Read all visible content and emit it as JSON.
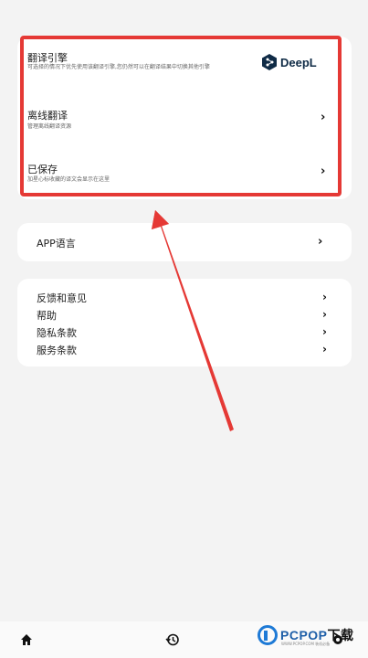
{
  "engine_card": {
    "translation_engine": {
      "title": "翻译引擎",
      "desc": "可选择的情况下优先使用该翻译引擎,您仍然可以在翻译结果中切换其他引擎",
      "logo_text": "DeepL",
      "logo_icon": "deepl-logo-icon"
    },
    "offline": {
      "title": "离线翻译",
      "desc": "管理离线翻译资源"
    },
    "saved": {
      "title": "已保存",
      "desc": "加星心标收藏的译文会显示在这里"
    }
  },
  "app_language": {
    "label": "APP语言"
  },
  "menu": {
    "items": [
      {
        "label": "反馈和意见"
      },
      {
        "label": "帮助"
      },
      {
        "label": "隐私条款"
      },
      {
        "label": "服务条款"
      }
    ]
  },
  "bottom_nav": {
    "items": [
      "home-icon",
      "history-icon",
      "settings-icon"
    ]
  },
  "watermark": {
    "brand": "PCPOP",
    "suffix": "下载",
    "sub": "WWW.PCPOP.COM 装机必备"
  },
  "colors": {
    "highlight": "#e53935",
    "accent": "#1e7ad6"
  }
}
